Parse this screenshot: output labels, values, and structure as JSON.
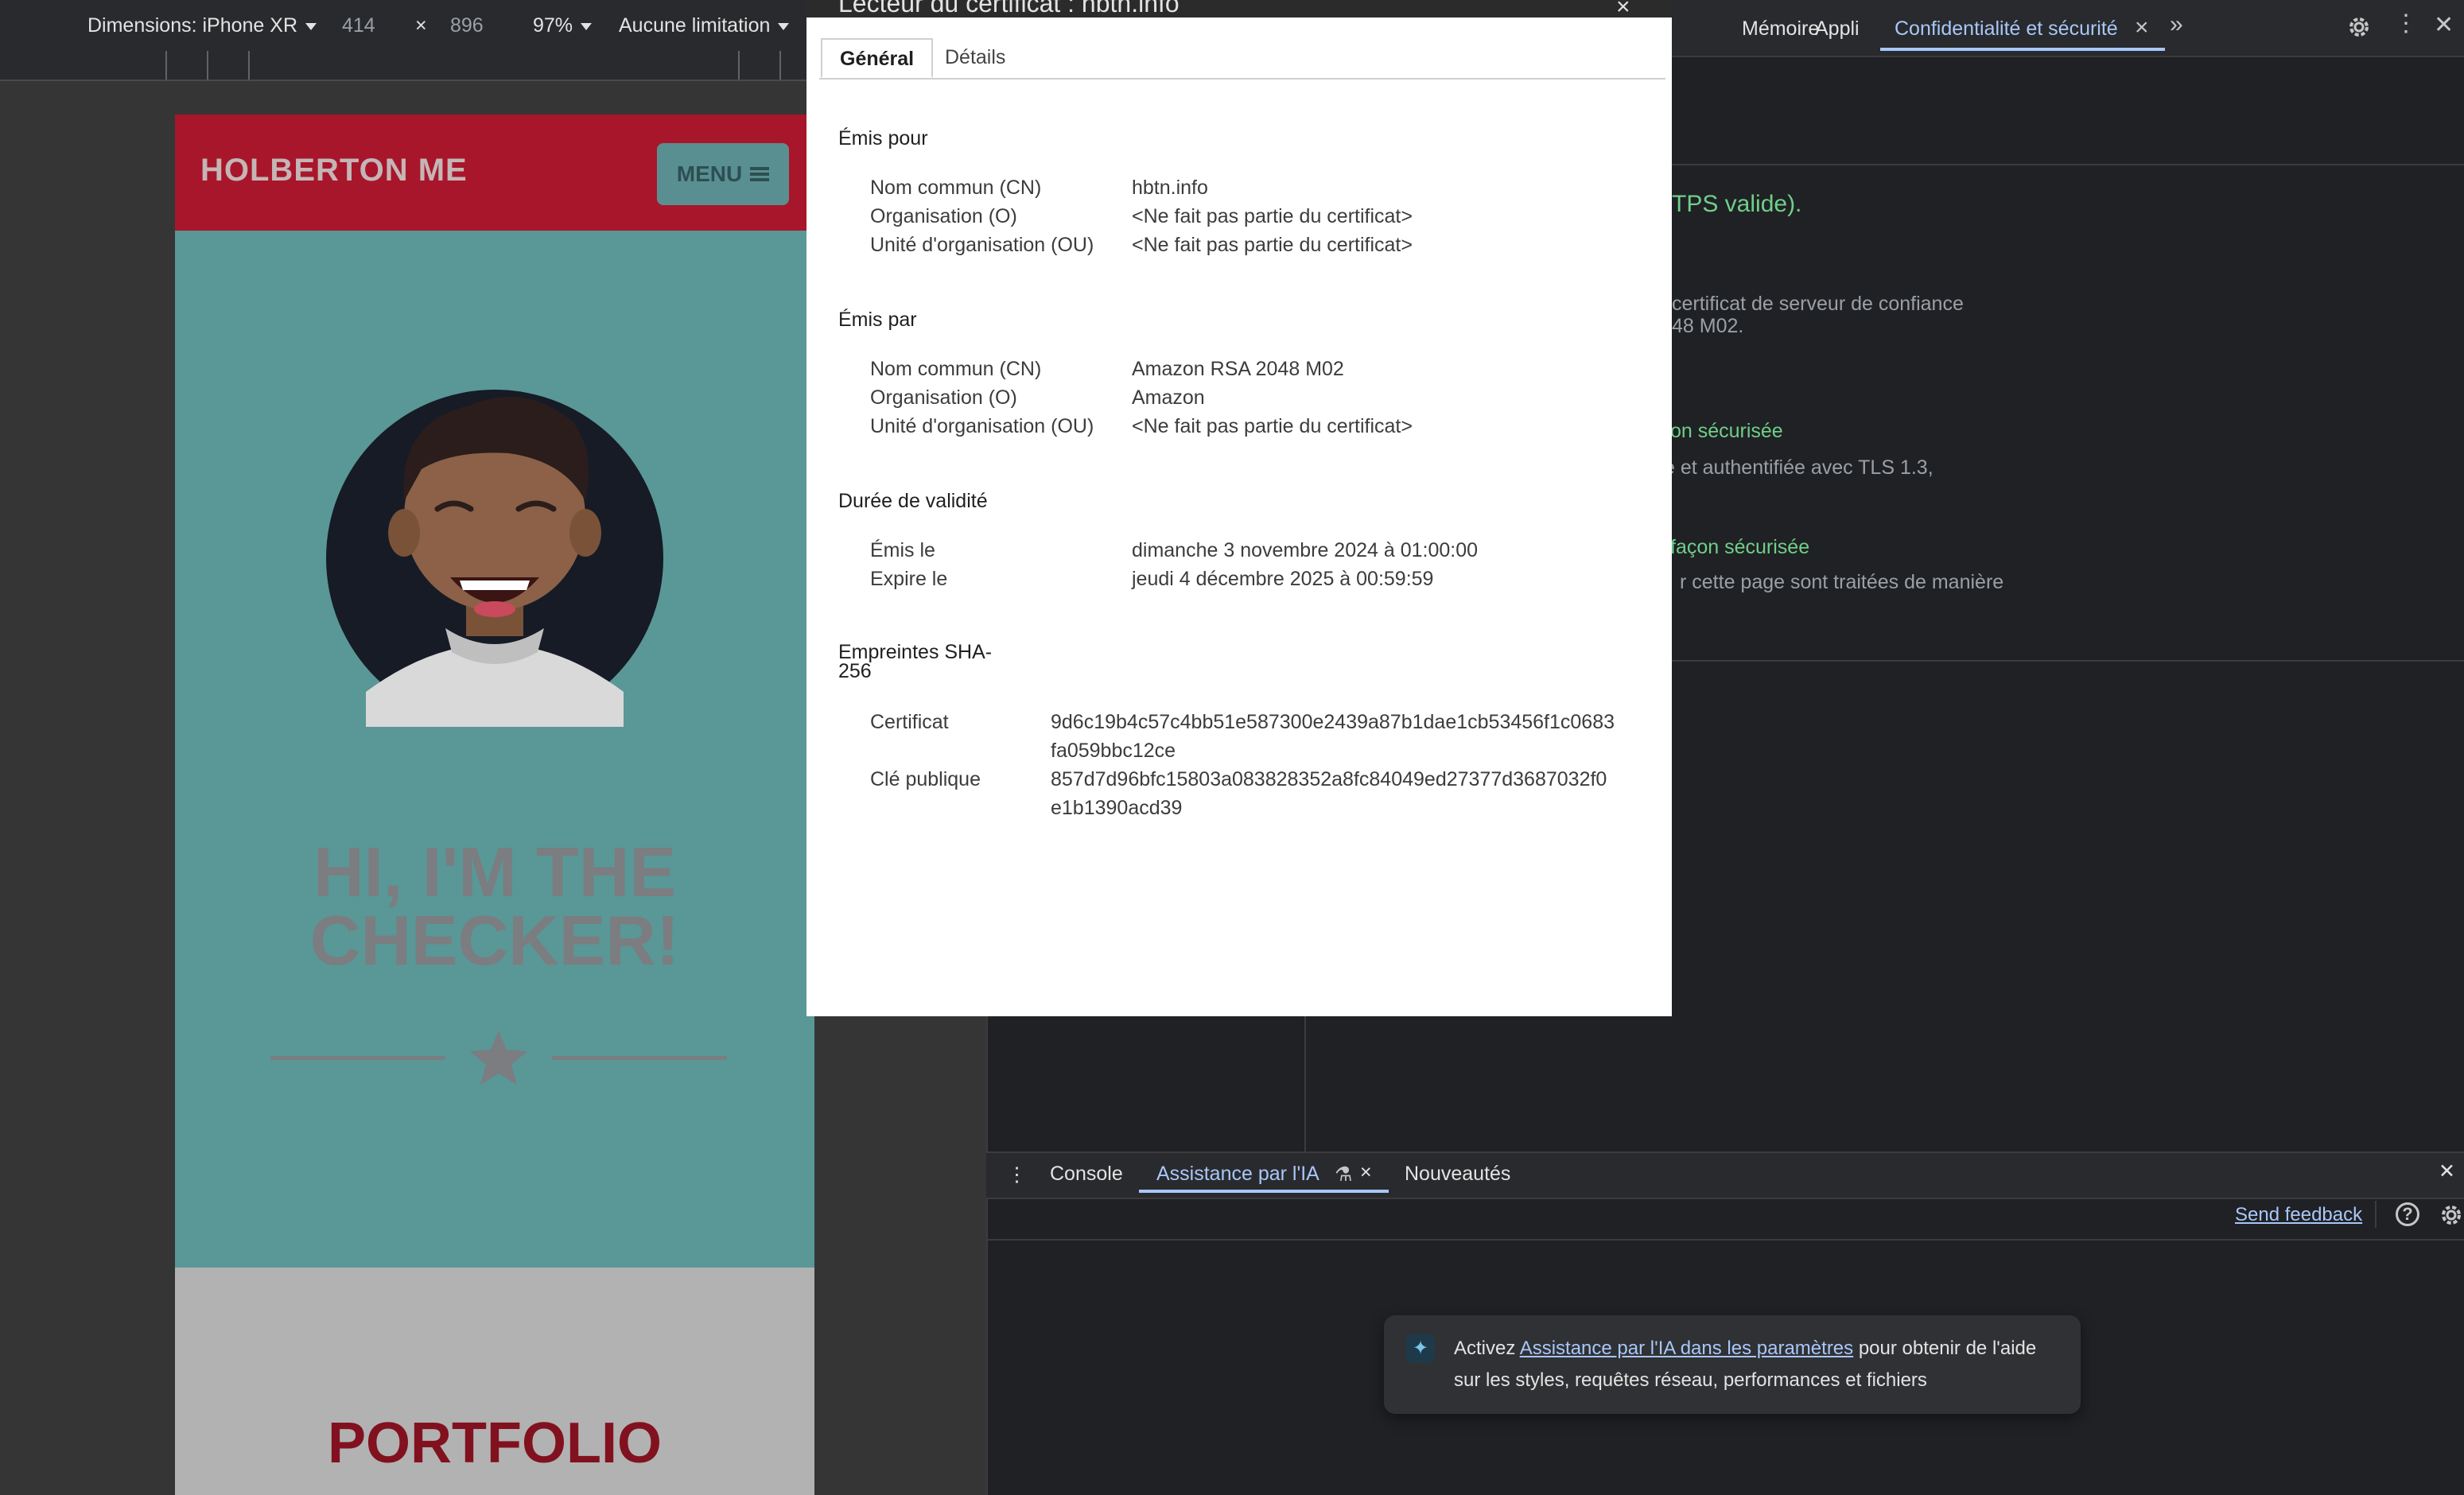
{
  "device_toolbar": {
    "dimensions_label": "Dimensions: iPhone XR",
    "width": "414",
    "times": "×",
    "height": "896",
    "zoom": "97%",
    "throttle": "Aucune limitation"
  },
  "website": {
    "logo": "HOLBERTON ME",
    "menu_label": "MENU",
    "hero_title_line1": "HI, I'M THE",
    "hero_title_line2": "CHECKER!",
    "portfolio_title": "PORTFOLIO",
    "colors": {
      "header": "#a8162b",
      "hero": "#5a9797",
      "portfolio": "#b2b2b2"
    }
  },
  "devtools": {
    "tabs": [
      "Mémoire",
      "Appli",
      "Confidentialité et sécurité"
    ],
    "active_tab": "Confidentialité et sécurité",
    "more_tabs_icon": "chevron-double-right-icon",
    "security": {
      "https_valid_fragment": "TPS valide).",
      "cert_text_line1": "certificat de serveur de confiance",
      "cert_text_line2": "48 M02.",
      "connection_title_fragment": "exion sécurisée",
      "connection_text": "e et authentifiée avec TLS 1.3,",
      "resources_title_fragment": "façon sécurisée",
      "resources_text": "r cette page sont traitées de manière"
    },
    "drawer": {
      "tabs": [
        "Console",
        "Assistance par l'IA",
        "Nouveautés"
      ],
      "active_tab": "Assistance par l'IA",
      "send_feedback": "Send feedback",
      "banner_prefix": "Activez ",
      "banner_link": "Assistance par l'IA dans les paramètres",
      "banner_suffix": " pour obtenir de l'aide sur les styles, requêtes réseau, performances et fichiers"
    }
  },
  "certificate": {
    "title": "Lecteur du certificat : hbtn.info",
    "tabs": [
      "Général",
      "Détails"
    ],
    "active_tab": "Général",
    "issued_to": {
      "heading": "Émis pour",
      "rows": [
        {
          "label": "Nom commun (CN)",
          "value": "hbtn.info"
        },
        {
          "label": "Organisation (O)",
          "value": "<Ne fait pas partie du certificat>"
        },
        {
          "label": "Unité d'organisation (OU)",
          "value": "<Ne fait pas partie du certificat>"
        }
      ]
    },
    "issued_by": {
      "heading": "Émis par",
      "rows": [
        {
          "label": "Nom commun (CN)",
          "value": "Amazon RSA 2048 M02"
        },
        {
          "label": "Organisation (O)",
          "value": "Amazon"
        },
        {
          "label": "Unité d'organisation (OU)",
          "value": "<Ne fait pas partie du certificat>"
        }
      ]
    },
    "validity": {
      "heading": "Durée de validité",
      "rows": [
        {
          "label": "Émis le",
          "value": "dimanche 3 novembre 2024 à 01:00:00"
        },
        {
          "label": "Expire le",
          "value": "jeudi 4 décembre 2025 à 00:59:59"
        }
      ]
    },
    "fingerprints": {
      "heading_line1": "Empreintes SHA-",
      "heading_line2": "256",
      "rows": [
        {
          "label": "Certificat",
          "value_line1": "9d6c19b4c57c4bb51e587300e2439a87b1dae1cb53456f1c0683",
          "value_line2": "fa059bbc12ce"
        },
        {
          "label": "Clé publique",
          "value_line1": "857d7d96bfc15803a083828352a8fc84049ed27377d3687032f0",
          "value_line2": "e1b1390acd39"
        }
      ]
    }
  }
}
